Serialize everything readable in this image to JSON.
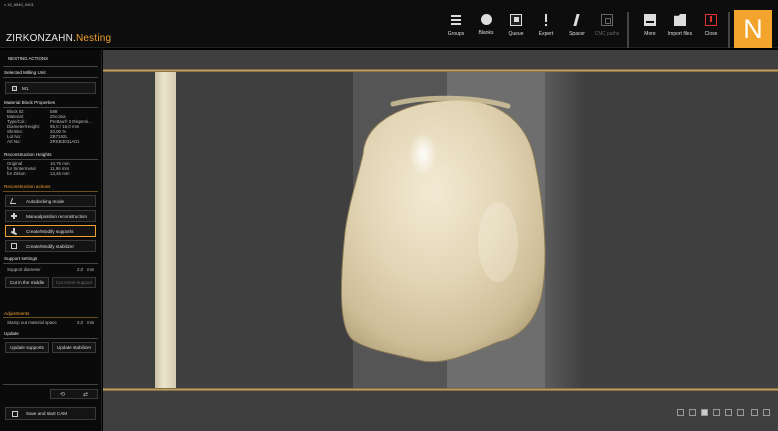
{
  "window": {
    "title": "v 15_6540_0401"
  },
  "app": {
    "brand": "ZIRKONZAHN.",
    "product": "Nesting"
  },
  "toolbar": {
    "groups": "Groups",
    "blanks": "Blanks",
    "queue": "Queue",
    "expert": "Expert",
    "spacer": "Spacer",
    "cnc_paths": "CNC paths",
    "more": "More",
    "import_files": "Import files",
    "close": "Close"
  },
  "logo_letter": "N",
  "sidebar": {
    "header": "NESTING ACTIONS",
    "milling_unit": {
      "title": "Selected Milling Unit",
      "value": "M1"
    },
    "block": {
      "title": "Material Block Properties",
      "rows": [
        {
          "k": "Block ID:",
          "v": "589"
        },
        {
          "k": "Material:",
          "v": "Zirconia"
        },
        {
          "k": "Type/Col.:",
          "v": "Prettau® 2 Dispersi..."
        },
        {
          "k": "Diameter/Height:",
          "v": "95,0 / 16,0 mm"
        },
        {
          "k": "Shrinks:",
          "v": "20,00 %"
        },
        {
          "k": "Lot No:",
          "v": "ZB7192L"
        },
        {
          "k": "Art No:",
          "v": "ZRKB3031A01"
        }
      ]
    },
    "heights": {
      "title": "Reconstruction Heights",
      "rows": [
        {
          "k": "Original",
          "v": "10,76 mm"
        },
        {
          "k": "for Sintermetal",
          "v": "11,96 mm"
        },
        {
          "k": "for Zirkon",
          "v": "13,45 mm"
        }
      ]
    },
    "actions": {
      "title": "Reconstruction actions",
      "autodocking": "Autodocking mode",
      "manual": "Manualposition reconstruction",
      "supports": "Create/Modify supports",
      "stabilizer": "Create/Modify stabilizer"
    },
    "support": {
      "title": "Support settings",
      "diameter_label": "Support diameter",
      "diameter_value": "2,0",
      "unit": "mm",
      "cut_middle": "Cut in the middle",
      "cut_entire": "Cut entire support"
    },
    "adjustments": {
      "title": "Adjustments",
      "stamp_label": "Stamp out material space",
      "stamp_value": "3,0",
      "unit": "mm"
    },
    "update": {
      "title": "Update",
      "supports": "Update supports",
      "stabilizer": "Update stabilizer"
    },
    "save": "Save and start CAM"
  },
  "colors": {
    "accent": "#f3a42d",
    "close": "#e03030"
  }
}
